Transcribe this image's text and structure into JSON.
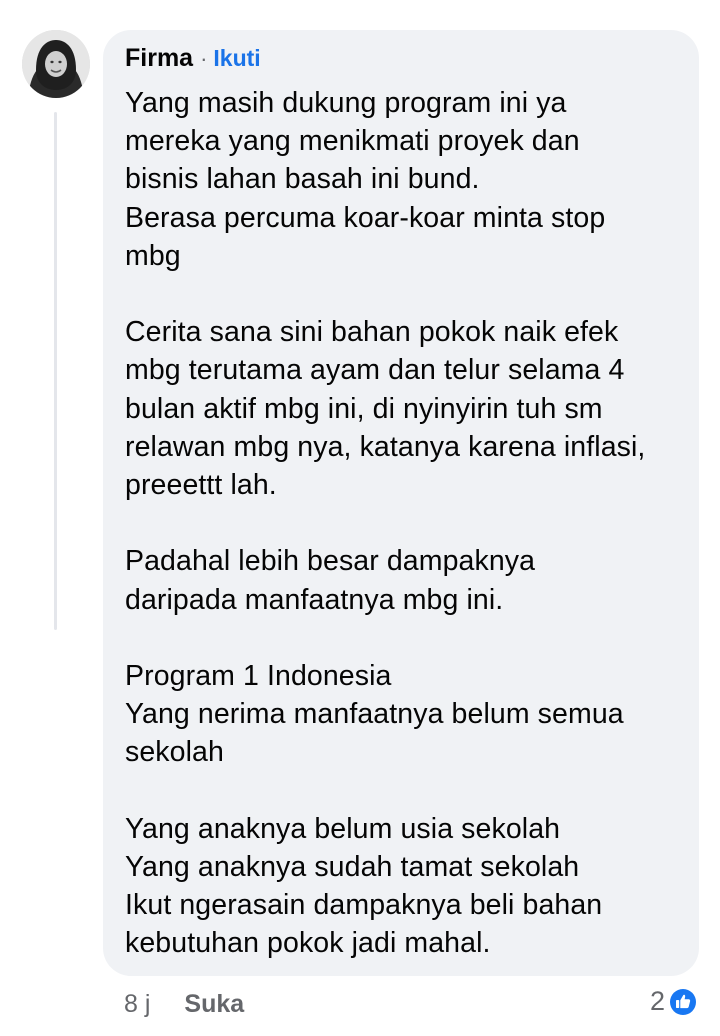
{
  "comment": {
    "author": "Firma",
    "separator": "·",
    "follow_label": "Ikuti",
    "text": "Yang masih dukung program ini ya\nmereka yang menikmati proyek dan\nbisnis lahan basah ini bund.\nBerasa percuma koar-koar minta stop\nmbg\n\nCerita sana sini bahan pokok naik efek\nmbg terutama ayam dan telur selama 4\nbulan aktif mbg ini, di nyinyirin tuh sm\nrelawan mbg nya, katanya karena inflasi,\npreeettt lah.\n\nPadahal lebih besar dampaknya\ndaripada manfaatnya mbg ini.\n\nProgram 1 Indonesia\nYang nerima manfaatnya belum semua\nsekolah\n\nYang anaknya belum usia sekolah\nYang anaknya sudah tamat sekolah\nIkut ngerasain dampaknya beli bahan\nkebutuhan pokok jadi mahal.",
    "time": "8 j",
    "like_label": "Suka",
    "reaction_count": "2",
    "reaction_icon": "like-thumb-icon"
  },
  "colors": {
    "bubble_bg": "#f0f2f5",
    "link_blue": "#1a73e8",
    "muted_gray": "#65676b",
    "like_blue": "#1877f2"
  }
}
